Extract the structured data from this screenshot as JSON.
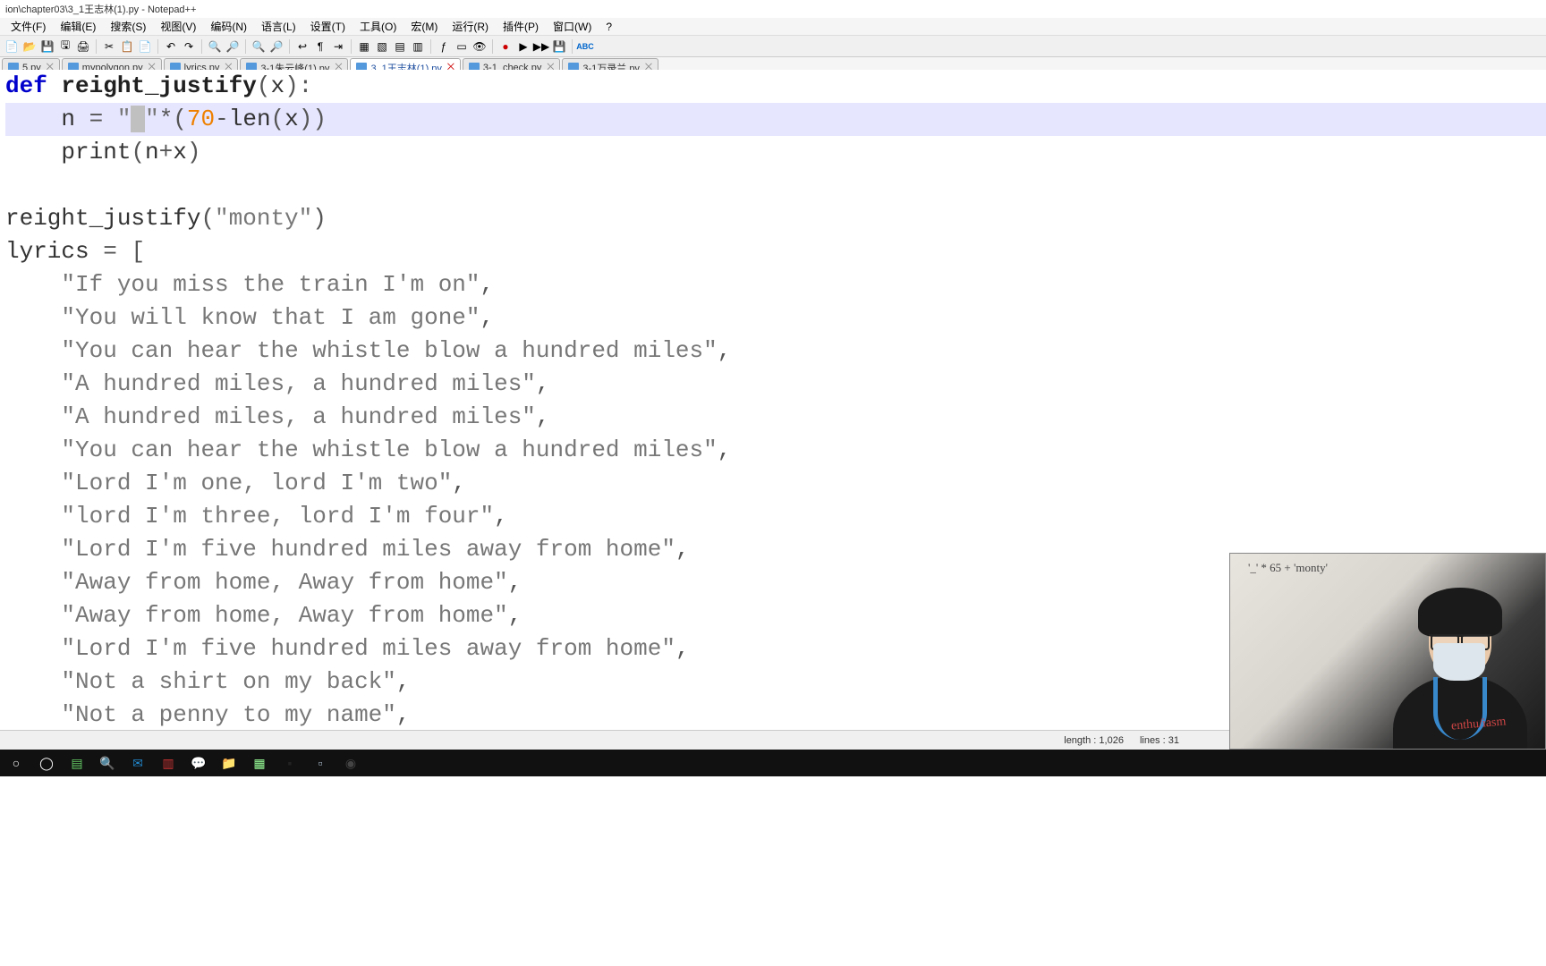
{
  "window": {
    "title": "ion\\chapter03\\3_1王志林(1).py - Notepad++"
  },
  "menu": {
    "items": [
      "文件(F)",
      "编辑(E)",
      "搜索(S)",
      "视图(V)",
      "编码(N)",
      "语言(L)",
      "设置(T)",
      "工具(O)",
      "宏(M)",
      "运行(R)",
      "插件(P)",
      "窗口(W)",
      "?"
    ]
  },
  "tabs": [
    {
      "label": "5.py",
      "active": false
    },
    {
      "label": "mypolygon.py",
      "active": false
    },
    {
      "label": "lyrics.py",
      "active": false
    },
    {
      "label": "3-1朱云峰(1).py",
      "active": false
    },
    {
      "label": "3_1王志林(1).py",
      "active": true
    },
    {
      "label": "3-1_check.py",
      "active": false
    },
    {
      "label": "3-1万录兰.py",
      "active": false
    }
  ],
  "code": {
    "lines": [
      {
        "type": "def",
        "raw": "def reight_justify(x):"
      },
      {
        "type": "assign",
        "raw": "    n = \" \"*(70-len(x))",
        "hl": true
      },
      {
        "type": "stmt",
        "raw": "    print(n+x)"
      },
      {
        "type": "blank",
        "raw": ""
      },
      {
        "type": "call",
        "raw": "reight_justify(\"monty\")"
      },
      {
        "type": "assign2",
        "raw": "lyrics = ["
      },
      {
        "type": "str",
        "text": "If you miss the train I'm on"
      },
      {
        "type": "str",
        "text": "You will know that I am gone"
      },
      {
        "type": "str",
        "text": "You can hear the whistle blow a hundred miles"
      },
      {
        "type": "str",
        "text": "A hundred miles, a hundred miles"
      },
      {
        "type": "str",
        "text": "A hundred miles, a hundred miles"
      },
      {
        "type": "str",
        "text": "You can hear the whistle blow a hundred miles"
      },
      {
        "type": "str",
        "text": "Lord I'm one, lord I'm two"
      },
      {
        "type": "str",
        "text": "lord I'm three, lord I'm four"
      },
      {
        "type": "str",
        "text": "Lord I'm five hundred miles away from home"
      },
      {
        "type": "str",
        "text": "Away from home, Away from home"
      },
      {
        "type": "str",
        "text": "Away from home, Away from home"
      },
      {
        "type": "str",
        "text": "Lord I'm five hundred miles away from home"
      },
      {
        "type": "str",
        "text": "Not a shirt on my back"
      },
      {
        "type": "str",
        "text": "Not a penny to my name"
      }
    ]
  },
  "status": {
    "length_label": "length :",
    "length_value": "1,026",
    "lines_label": "lines :",
    "lines_value": "31"
  },
  "webcam": {
    "board_text": "'_' * 65 + 'monty'"
  },
  "taskbar_icons": [
    "circle",
    "chrome",
    "files",
    "search",
    "outlook",
    "note",
    "wechat",
    "folder",
    "npp",
    "cmd",
    "vbox",
    "obs"
  ]
}
